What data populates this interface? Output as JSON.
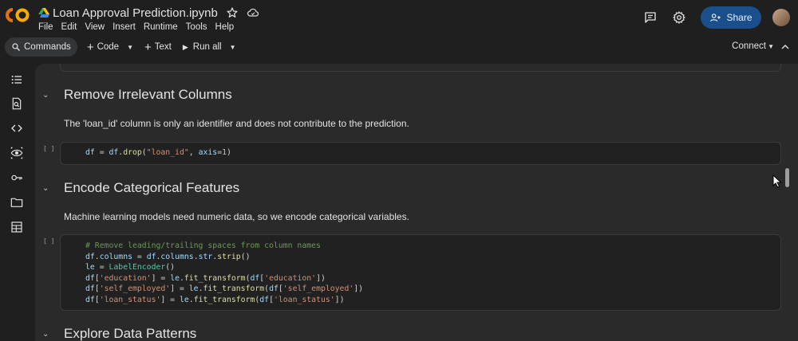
{
  "app": {
    "notebook_title": "Loan Approval Prediction.ipynb",
    "menu": [
      "File",
      "Edit",
      "View",
      "Insert",
      "Runtime",
      "Tools",
      "Help"
    ],
    "share_label": "Share"
  },
  "toolbar": {
    "commands_label": "Commands",
    "code_label": "Code",
    "text_label": "Text",
    "run_all_label": "Run all",
    "connect_label": "Connect"
  },
  "sections": [
    {
      "heading": "Remove Irrelevant Columns",
      "text": "The 'loan_id' column is only an identifier and does not contribute to the prediction.",
      "cell_marker": "[ ]"
    },
    {
      "heading": "Encode Categorical Features",
      "text": "Machine learning models need numeric data, so we encode categorical variables.",
      "cell_marker": "[ ]"
    },
    {
      "heading": "Explore Data Patterns"
    }
  ],
  "code": {
    "drop_line": "df = df.drop(\"loan_id\", axis=1)",
    "encode_lines": [
      "# Remove leading/trailing spaces from column names",
      "df.columns = df.columns.str.strip()",
      "le = LabelEncoder()",
      "df['education'] = le.fit_transform(df['education'])",
      "df['self_employed'] = le.fit_transform(df['self_employed'])",
      "df['loan_status'] = le.fit_transform(df['loan_status'])"
    ]
  },
  "colors": {
    "background": "#1f1f1f",
    "panel": "#2a2a2a",
    "share_button": "#1b4f8c",
    "logo_orange": "#f9ab00",
    "logo_dark_orange": "#e8710a"
  },
  "icons": {
    "rail": [
      "table-of-contents-icon",
      "find-replace-icon",
      "code-snippets-icon",
      "variables-inspector-icon",
      "secrets-key-icon",
      "files-folder-icon",
      "data-table-icon"
    ]
  }
}
